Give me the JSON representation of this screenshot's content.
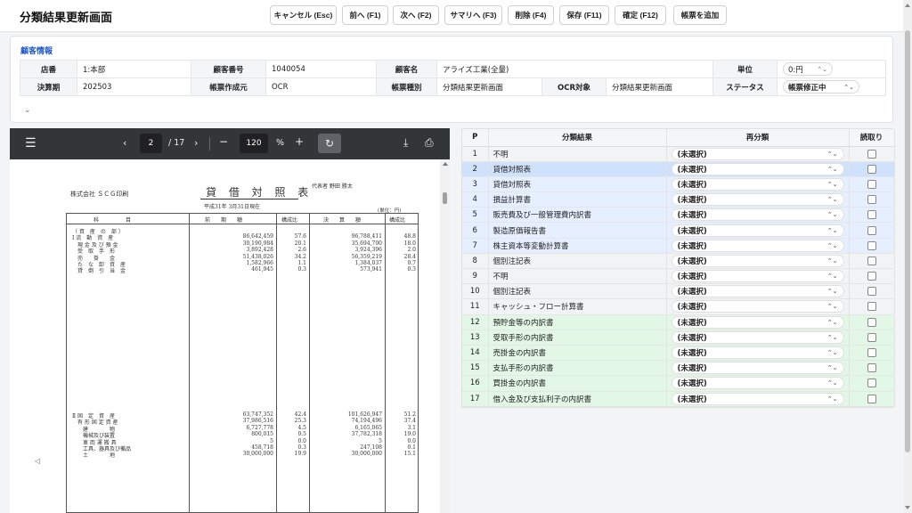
{
  "header": {
    "title": "分類結果更新画面",
    "buttons": [
      "キャンセル (Esc)",
      "前へ (F1)",
      "次へ (F2)",
      "サマリへ (F3)",
      "削除 (F4)",
      "保存 (F11)",
      "確定 (F12)",
      "帳票を追加"
    ]
  },
  "customer": {
    "section_title": "顧客情報",
    "labels": {
      "store": "店番",
      "customer_no": "顧客番号",
      "customer_name": "顧客名",
      "unit": "単位",
      "fiscal": "決算期",
      "source": "帳票作成元",
      "form_type": "帳票種別",
      "ocr_target": "OCR対象",
      "status": "ステータス"
    },
    "values": {
      "store": "1:本部",
      "customer_no": "1040054",
      "customer_name": "アライズ工業(全量)",
      "unit": "0:円",
      "fiscal": "202503",
      "source": "OCR",
      "form_type": "分類結果更新画面",
      "ocr_target": "分類結果更新画面",
      "status": "帳票修正中"
    }
  },
  "viewer": {
    "page": "2",
    "total": "/ 17",
    "zoom": "120",
    "pct": "%",
    "doc": {
      "company": "株式会社 ＳＣＧ印刷",
      "title": "貸 借 対 照 表",
      "rep": "代表者 野田 勝太",
      "date": "平成31年 3月31日現在",
      "unit": "(単位：円)",
      "headers": {
        "item": "科　　　　　目",
        "prev": "前　　期　　額",
        "ratio1": "構成比",
        "curr": "決　　算　　額",
        "ratio2": "構成比"
      },
      "rows": [
        {
          "item": "（ 資　産　の　部 ）",
          "prev": "",
          "r1": "",
          "curr": "",
          "r2": ""
        },
        {
          "item": "Ⅰ 流　動　資　産",
          "prev": "86,642,459",
          "r1": "57.6",
          "curr": "96,788,411",
          "r2": "48.8"
        },
        {
          "item": "　現 金 及 び 預 金",
          "prev": "30,190,984",
          "r1": "20.1",
          "curr": "35,694,700",
          "r2": "18.0"
        },
        {
          "item": "　受　取　手　形",
          "prev": "3,892,428",
          "r1": "2.6",
          "curr": "3,924,396",
          "r2": "2.0"
        },
        {
          "item": "　売　　掛　　金",
          "prev": "51,438,026",
          "r1": "34.2",
          "curr": "56,359,219",
          "r2": "28.4"
        },
        {
          "item": "　た　な　卸　資　産",
          "prev": "1,582,966",
          "r1": "1.1",
          "curr": "1,384,037",
          "r2": "0.7"
        },
        {
          "item": "　貸　倒　引　当　金",
          "prev": "461,945",
          "r1": "0.3",
          "curr": "573,941",
          "r2": "0.3"
        }
      ],
      "rows2": [
        {
          "item": "Ⅱ 固　定　資　産",
          "prev": "63,747,352",
          "r1": "42.4",
          "curr": "101,626,947",
          "r2": "51.2"
        },
        {
          "item": "　有 形 固 定 資 産",
          "prev": "37,986,516",
          "r1": "25.3",
          "curr": "74,194,496",
          "r2": "37.4"
        },
        {
          "item": "　　建　　　　物",
          "prev": "6,727,778",
          "r1": "4.5",
          "curr": "6,165,065",
          "r2": "3.1"
        },
        {
          "item": "　　機械及び装置",
          "prev": "800,015",
          "r1": "0.5",
          "curr": "37,782,318",
          "r2": "19.0"
        },
        {
          "item": "　　車 両 運 搬 具",
          "prev": "5",
          "r1": "0.0",
          "curr": "5",
          "r2": "0.0"
        },
        {
          "item": "　　工具、器具及び備品",
          "prev": "458,718",
          "r1": "0.3",
          "curr": "247,108",
          "r2": "0.1"
        },
        {
          "item": "　　土　　　　地",
          "prev": "30,000,000",
          "r1": "19.9",
          "curr": "30,000,000",
          "r2": "15.1"
        }
      ]
    }
  },
  "table": {
    "headers": {
      "p": "P",
      "result": "分類結果",
      "reclass": "再分類",
      "read": "読取り"
    },
    "select_default": "(未選択)",
    "rows": [
      {
        "p": "1",
        "name": "不明",
        "style": "gray"
      },
      {
        "p": "2",
        "name": "貸借対照表",
        "style": "sel"
      },
      {
        "p": "3",
        "name": "貸借対照表",
        "style": "blue"
      },
      {
        "p": "4",
        "name": "損益計算書",
        "style": "blue"
      },
      {
        "p": "5",
        "name": "販売費及び一般管理費内訳書",
        "style": "blue"
      },
      {
        "p": "6",
        "name": "製造原価報告書",
        "style": "blue"
      },
      {
        "p": "7",
        "name": "株主資本等変動計算書",
        "style": "blue"
      },
      {
        "p": "8",
        "name": "個別注記表",
        "style": "gray"
      },
      {
        "p": "9",
        "name": "不明",
        "style": "gray"
      },
      {
        "p": "10",
        "name": "個別注記表",
        "style": "gray"
      },
      {
        "p": "11",
        "name": "キャッシュ・フロー計算書",
        "style": "gray"
      },
      {
        "p": "12",
        "name": "預貯金等の内訳書",
        "style": "green"
      },
      {
        "p": "13",
        "name": "受取手形の内訳書",
        "style": "green"
      },
      {
        "p": "14",
        "name": "売掛金の内訳書",
        "style": "green"
      },
      {
        "p": "15",
        "name": "支払手形の内訳書",
        "style": "green"
      },
      {
        "p": "16",
        "name": "買掛金の内訳書",
        "style": "green"
      },
      {
        "p": "17",
        "name": "借入金及び支払利子の内訳書",
        "style": "green"
      }
    ]
  }
}
